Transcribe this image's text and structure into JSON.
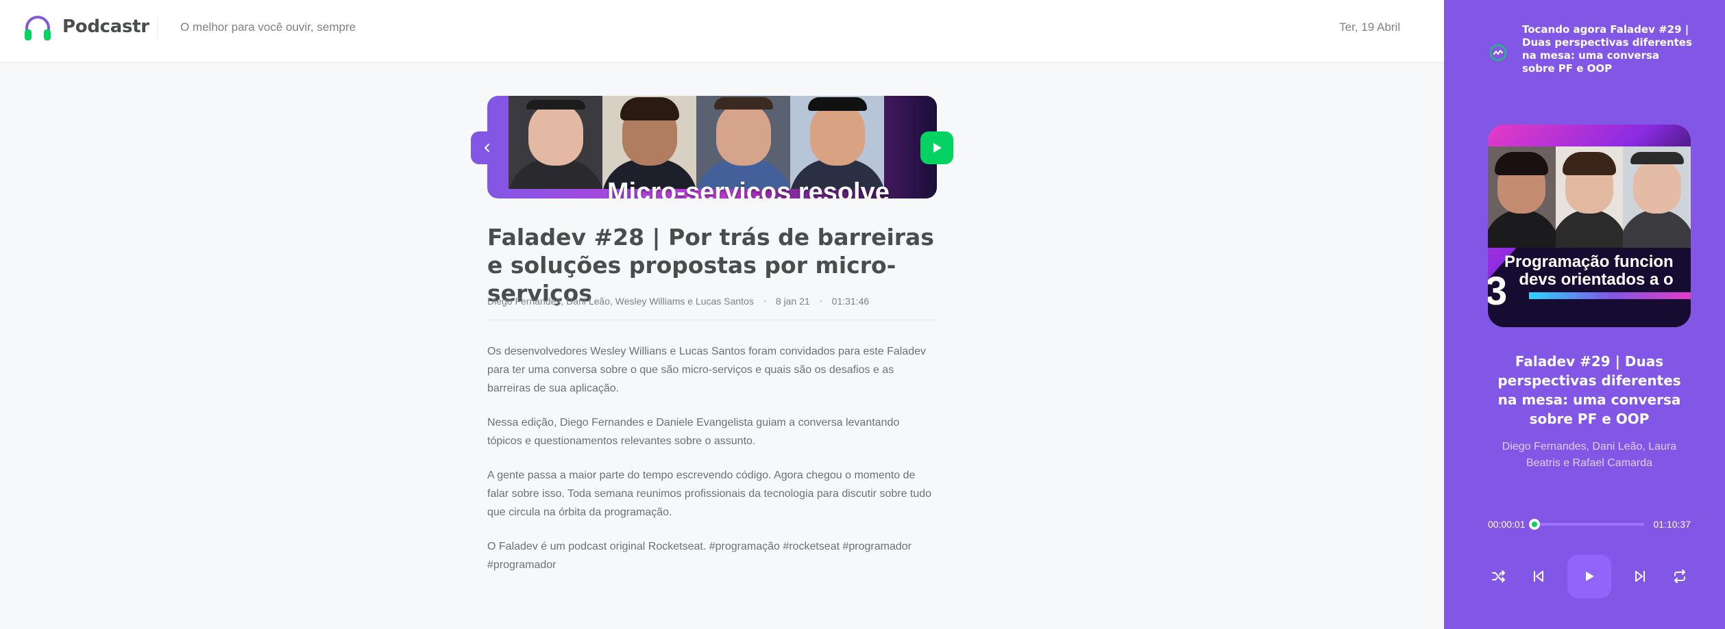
{
  "header": {
    "app_name": "Podcastr",
    "tagline": "O melhor para você ouvir, sempre",
    "date": "Ter, 19 Abril"
  },
  "episode": {
    "thumbnail_text": "Micro-serviços resolve",
    "title": "Faladev #28 | Por trás de barreiras e soluções propostas por micro-serviços",
    "members": "Diego Fernandes, Dani Leão, Wesley Williams e Lucas Santos",
    "published_at": "8 jan 21",
    "duration": "01:31:46",
    "description": [
      "Os desenvolvedores Wesley Willians e Lucas Santos foram convidados para este Faladev para ter uma conversa sobre o que são micro-serviços e quais são os desafios e as barreiras de sua aplicação.",
      "Nessa edição, Diego Fernandes e Daniele Evangelista guiam a conversa levantando tópicos e questionamentos relevantes sobre o assunto.",
      "A gente passa a maior parte do tempo escrevendo código. Agora chegou o momento de falar sobre isso. Toda semana reunimos profissionais da tecnologia para discutir sobre tudo que circula na órbita da programação.",
      "O Faladev é um podcast original Rocketseat. #programação #rocketseat #programador #programador"
    ]
  },
  "player": {
    "now_playing": "Tocando agora Faladev #29 | Duas perspectivas diferentes na mesa: uma conversa sobre PF e OOP",
    "cover_text_line1": "Programação funcion",
    "cover_text_line2": "devs orientados a o",
    "cover_number": "3",
    "title": "Faladev #29 | Duas perspectivas diferentes na mesa: uma conversa sobre PF e OOP",
    "members": "Diego Fernandes, Dani Leão, Laura Beatris e Rafael Camarda",
    "current_time": "00:00:01",
    "total_time": "01:10:37",
    "progress_fraction": 0.0002
  },
  "colors": {
    "purple": "#8257e5",
    "green": "#04d361",
    "text": "#494d4b"
  },
  "icons": {
    "logo": "headphones-icon",
    "now_playing": "playing-wave-icon",
    "shuffle": "shuffle-icon",
    "previous": "skip-previous-icon",
    "play": "play-icon",
    "next": "skip-next-icon",
    "repeat": "repeat-icon",
    "back": "chevron-left-icon"
  }
}
